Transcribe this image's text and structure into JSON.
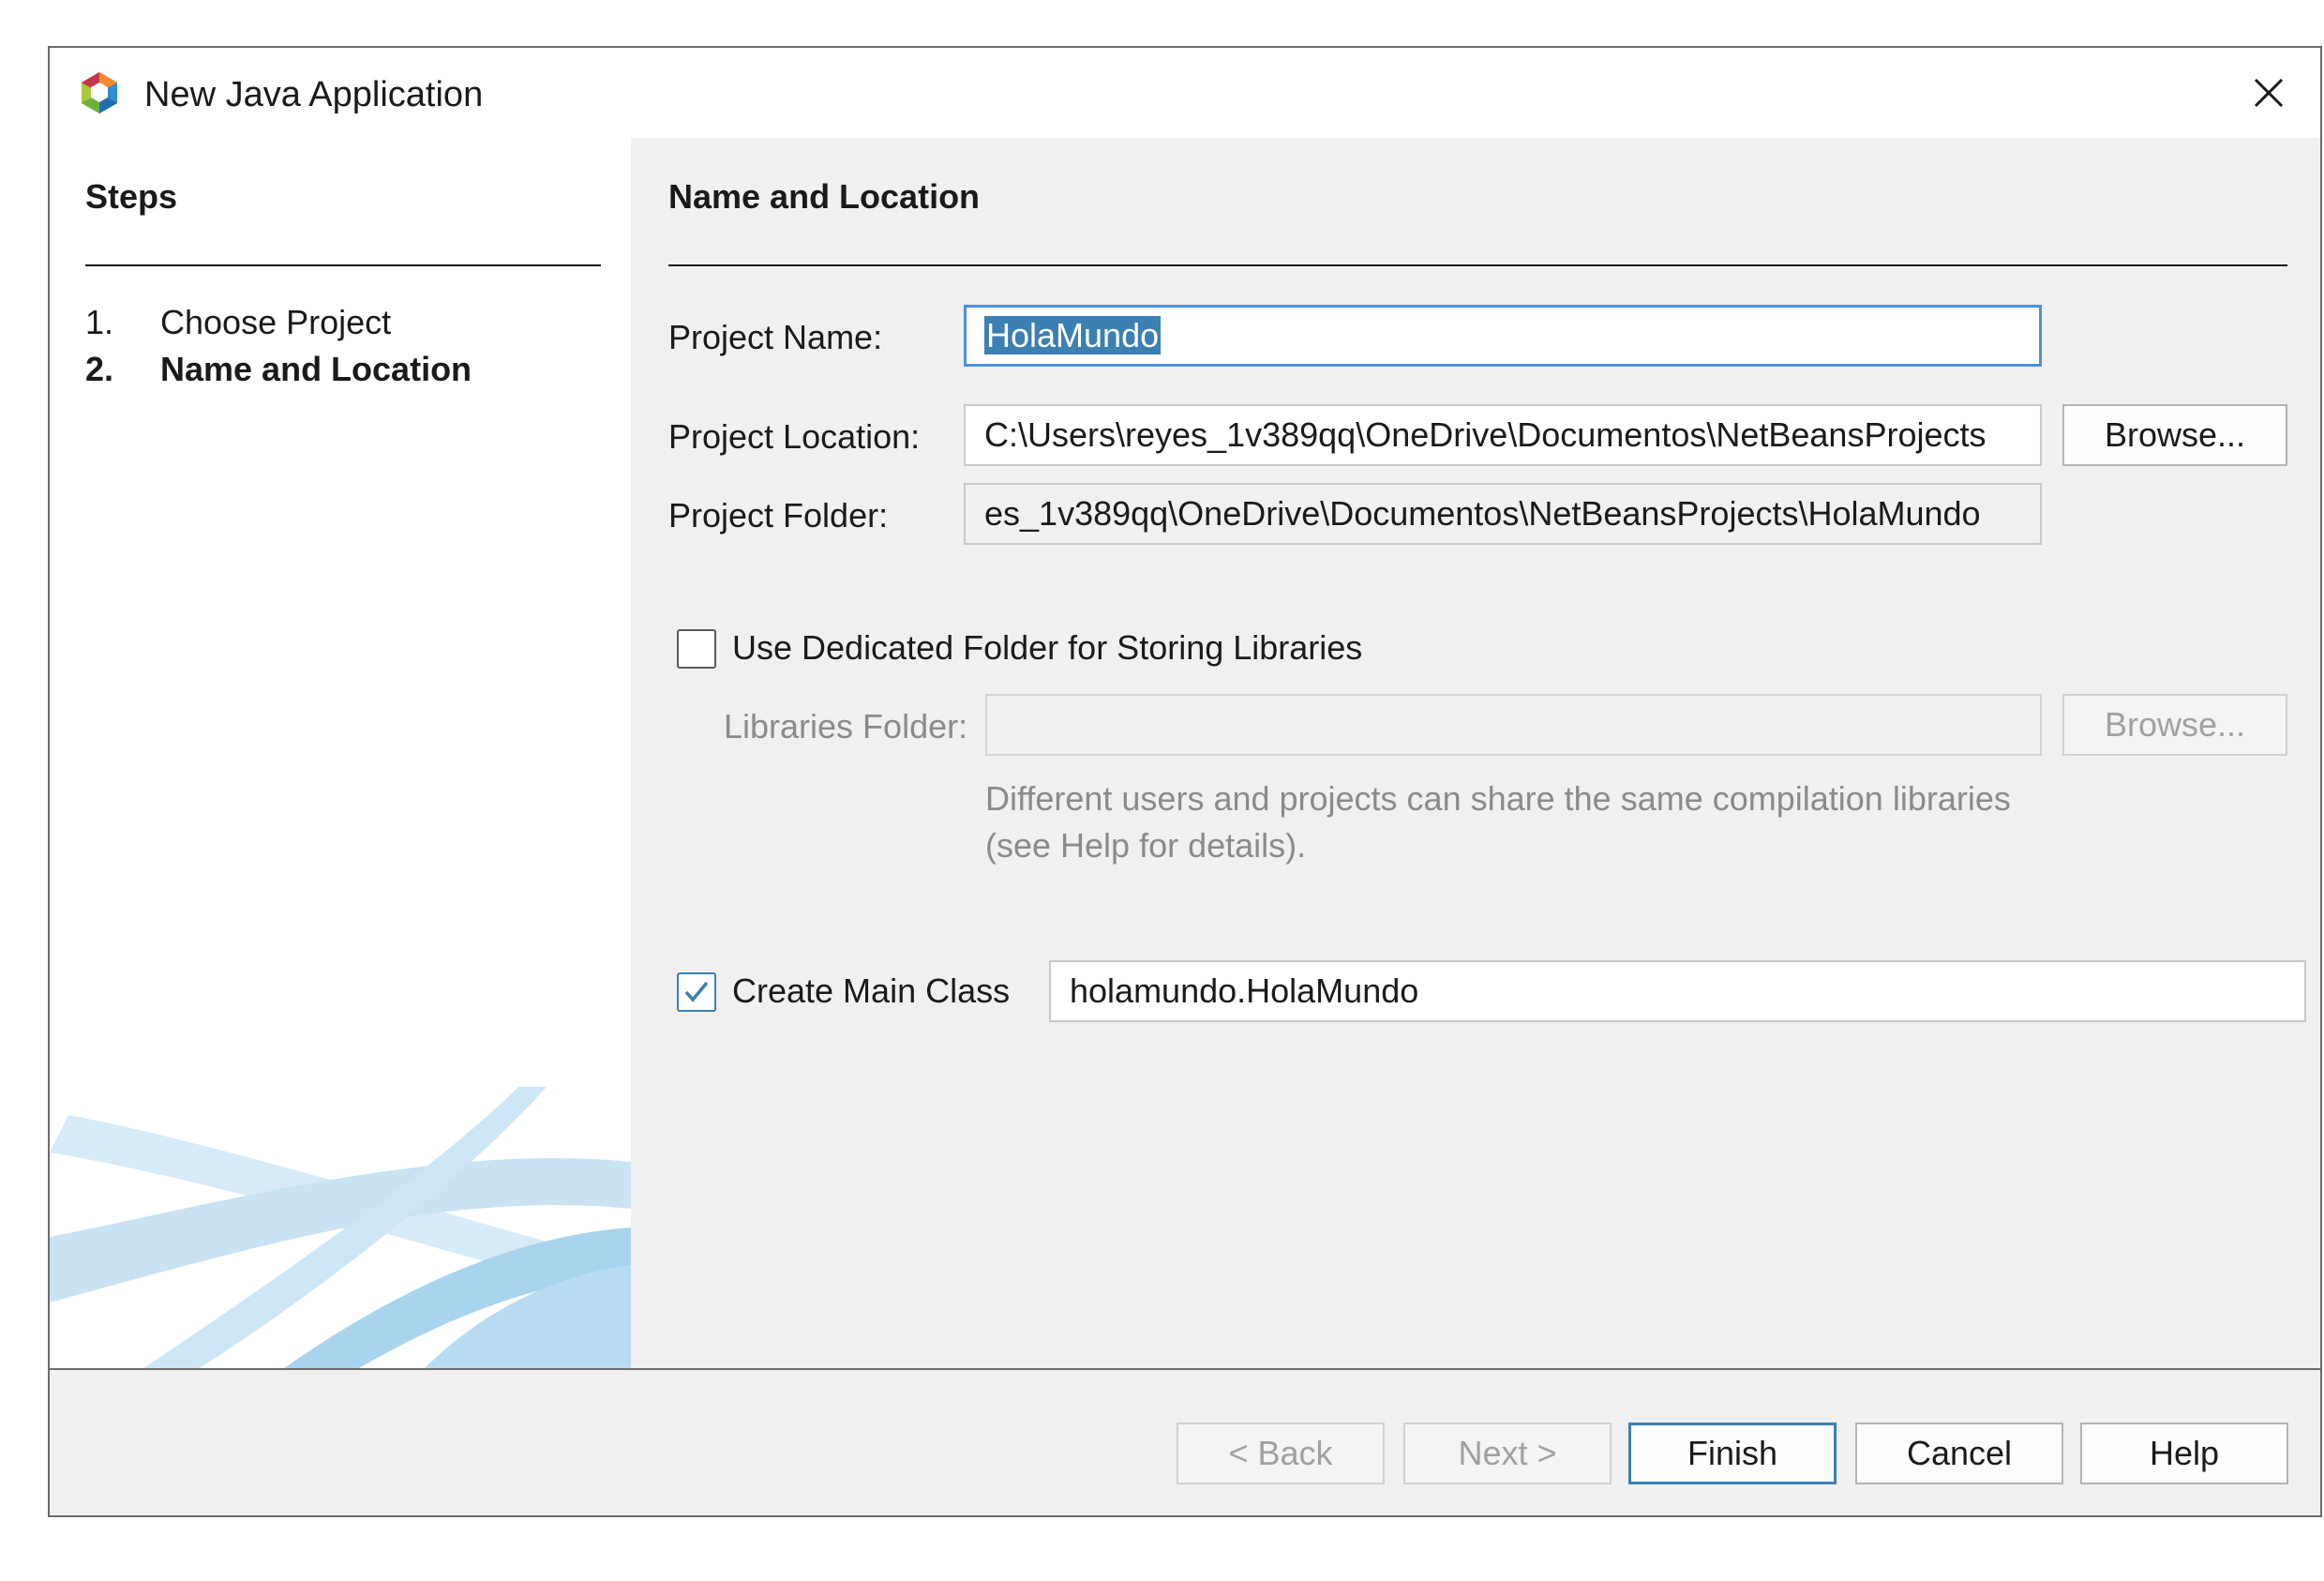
{
  "window": {
    "title": "New Java Application",
    "close_glyph": "✕"
  },
  "steps": {
    "title": "Steps",
    "items": [
      {
        "num": "1.",
        "label": "Choose Project"
      },
      {
        "num": "2.",
        "label": "Name and Location"
      }
    ]
  },
  "form": {
    "section_title": "Name and Location",
    "project_name": {
      "label": "Project Name:",
      "value": "HolaMundo"
    },
    "project_location": {
      "label": "Project Location:",
      "value": "C:\\Users\\reyes_1v389qq\\OneDrive\\Documentos\\NetBeansProjects",
      "browse": "Browse..."
    },
    "project_folder": {
      "label": "Project Folder:",
      "value": "es_1v389qq\\OneDrive\\Documentos\\NetBeansProjects\\HolaMundo"
    },
    "dedicated_folder": {
      "label": "Use Dedicated Folder for Storing Libraries",
      "checked": false
    },
    "libraries_folder": {
      "label": "Libraries Folder:",
      "value": "",
      "browse": "Browse..."
    },
    "hint_line1": "Different users and projects can share the same compilation libraries",
    "hint_line2": "(see Help for details).",
    "main_class": {
      "label": "Create Main Class",
      "checked": true,
      "value": "holamundo.HolaMundo"
    }
  },
  "buttons": {
    "back": "< Back",
    "next": "Next >",
    "finish": "Finish",
    "cancel": "Cancel",
    "help": "Help"
  },
  "colors": {
    "accent": "#3c7fb1",
    "focus": "#4a90d9",
    "disabled_text": "#8a8a8a"
  }
}
